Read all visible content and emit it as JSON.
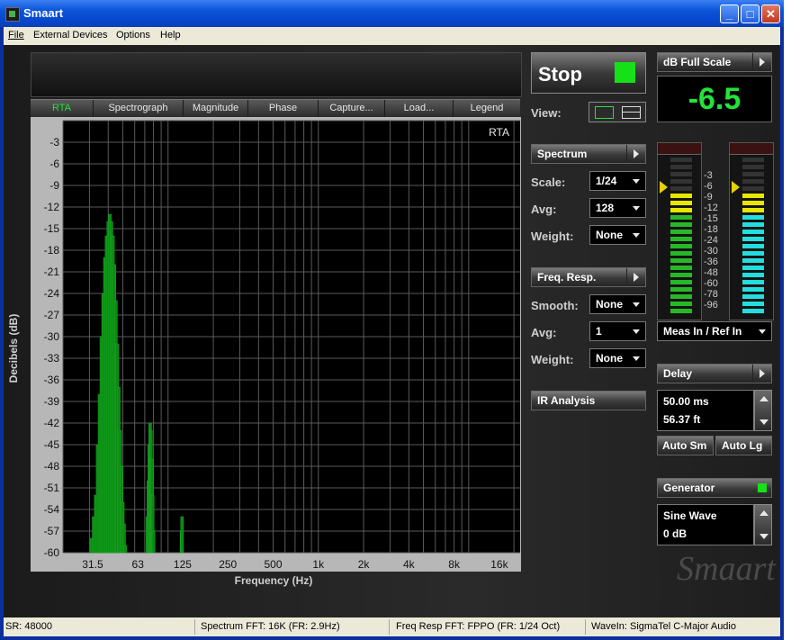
{
  "window": {
    "title": "Smaart"
  },
  "menu": [
    "File",
    "External Devices",
    "Options",
    "Help"
  ],
  "tabs": [
    "RTA",
    "Spectrograph",
    "Magnitude",
    "Phase",
    "Capture...",
    "Load...",
    "Legend"
  ],
  "colors": {
    "accent": "#23e23a",
    "plot_bg": "#000000",
    "bars": "#0c8a14",
    "meter_green": "#27b827",
    "meter_yellow": "#e6e600",
    "meter_cyan": "#22dede"
  },
  "chart_data": {
    "type": "bar",
    "title": "RTA",
    "ylabel": "Decibels (dB)",
    "xlabel": "Frequency (Hz)",
    "x_scale": "log",
    "ylim": [
      -60,
      0
    ],
    "xlim": [
      20,
      22000
    ],
    "y_ticks": [
      -3,
      -6,
      -9,
      -12,
      -15,
      -18,
      -21,
      -24,
      -27,
      -30,
      -33,
      -36,
      -39,
      -42,
      -45,
      -48,
      -51,
      -54,
      -57,
      -60
    ],
    "x_ticks": [
      "31.5",
      "63",
      "125",
      "250",
      "500",
      "1k",
      "2k",
      "4k",
      "8k",
      "16k"
    ],
    "x_tick_values": [
      31.5,
      63,
      125,
      250,
      500,
      1000,
      2000,
      4000,
      8000,
      16000
    ],
    "grid": true,
    "x": [
      31,
      32,
      33,
      34,
      35,
      36,
      37,
      38,
      39,
      40,
      41,
      42,
      43,
      44,
      45,
      46,
      47,
      48,
      49,
      50,
      51,
      52,
      73,
      74,
      75,
      76,
      77,
      78,
      79,
      80,
      123,
      124
    ],
    "values": [
      -58,
      -55,
      -52,
      -45,
      -38,
      -30,
      -24,
      -19,
      -16,
      -14,
      -13,
      -14,
      -16,
      -20,
      -25,
      -31,
      -37,
      -43,
      -48,
      -53,
      -56,
      -59,
      -55,
      -50,
      -45,
      -42,
      -43,
      -47,
      -52,
      -57,
      -57,
      -55
    ]
  },
  "controls": {
    "stop_label": "Stop",
    "view_label": "View:",
    "spectrum": {
      "header": "Spectrum",
      "scale_label": "Scale:",
      "scale": "1/24",
      "avg_label": "Avg:",
      "avg": "128",
      "weight_label": "Weight:",
      "weight": "None"
    },
    "freqresp": {
      "header": "Freq. Resp.",
      "smooth_label": "Smooth:",
      "smooth": "None",
      "avg_label": "Avg:",
      "avg": "1",
      "weight_label": "Weight:",
      "weight": "None"
    },
    "ir_label": "IR Analysis"
  },
  "right": {
    "dbfs_label": "dB Full Scale",
    "dbfs_value": "-6.5",
    "meter_scale": [
      "-3",
      "-6",
      "-9",
      "-12",
      "-15",
      "-18",
      "-24",
      "-30",
      "-36",
      "-48",
      "-60",
      "-78",
      "-96"
    ],
    "meter_left_level": -7,
    "meter_right_level": -7,
    "meas_select": "Meas In / Ref In",
    "delay_label": "Delay",
    "delay_ms": "50.00 ms",
    "delay_ft": "56.37 ft",
    "auto_sm": "Auto Sm",
    "auto_lg": "Auto Lg",
    "generator_label": "Generator",
    "gen_type": "Sine Wave",
    "gen_level": "0 dB",
    "logo": "Smaart"
  },
  "status": {
    "sr": "SR: 48000",
    "spectrum_fft": "Spectrum FFT: 16K (FR: 2.9Hz)",
    "freqresp_fft": "Freq Resp FFT: FPPO (FR: 1/24 Oct)",
    "wavein": "WaveIn: SigmaTel C-Major Audio"
  }
}
